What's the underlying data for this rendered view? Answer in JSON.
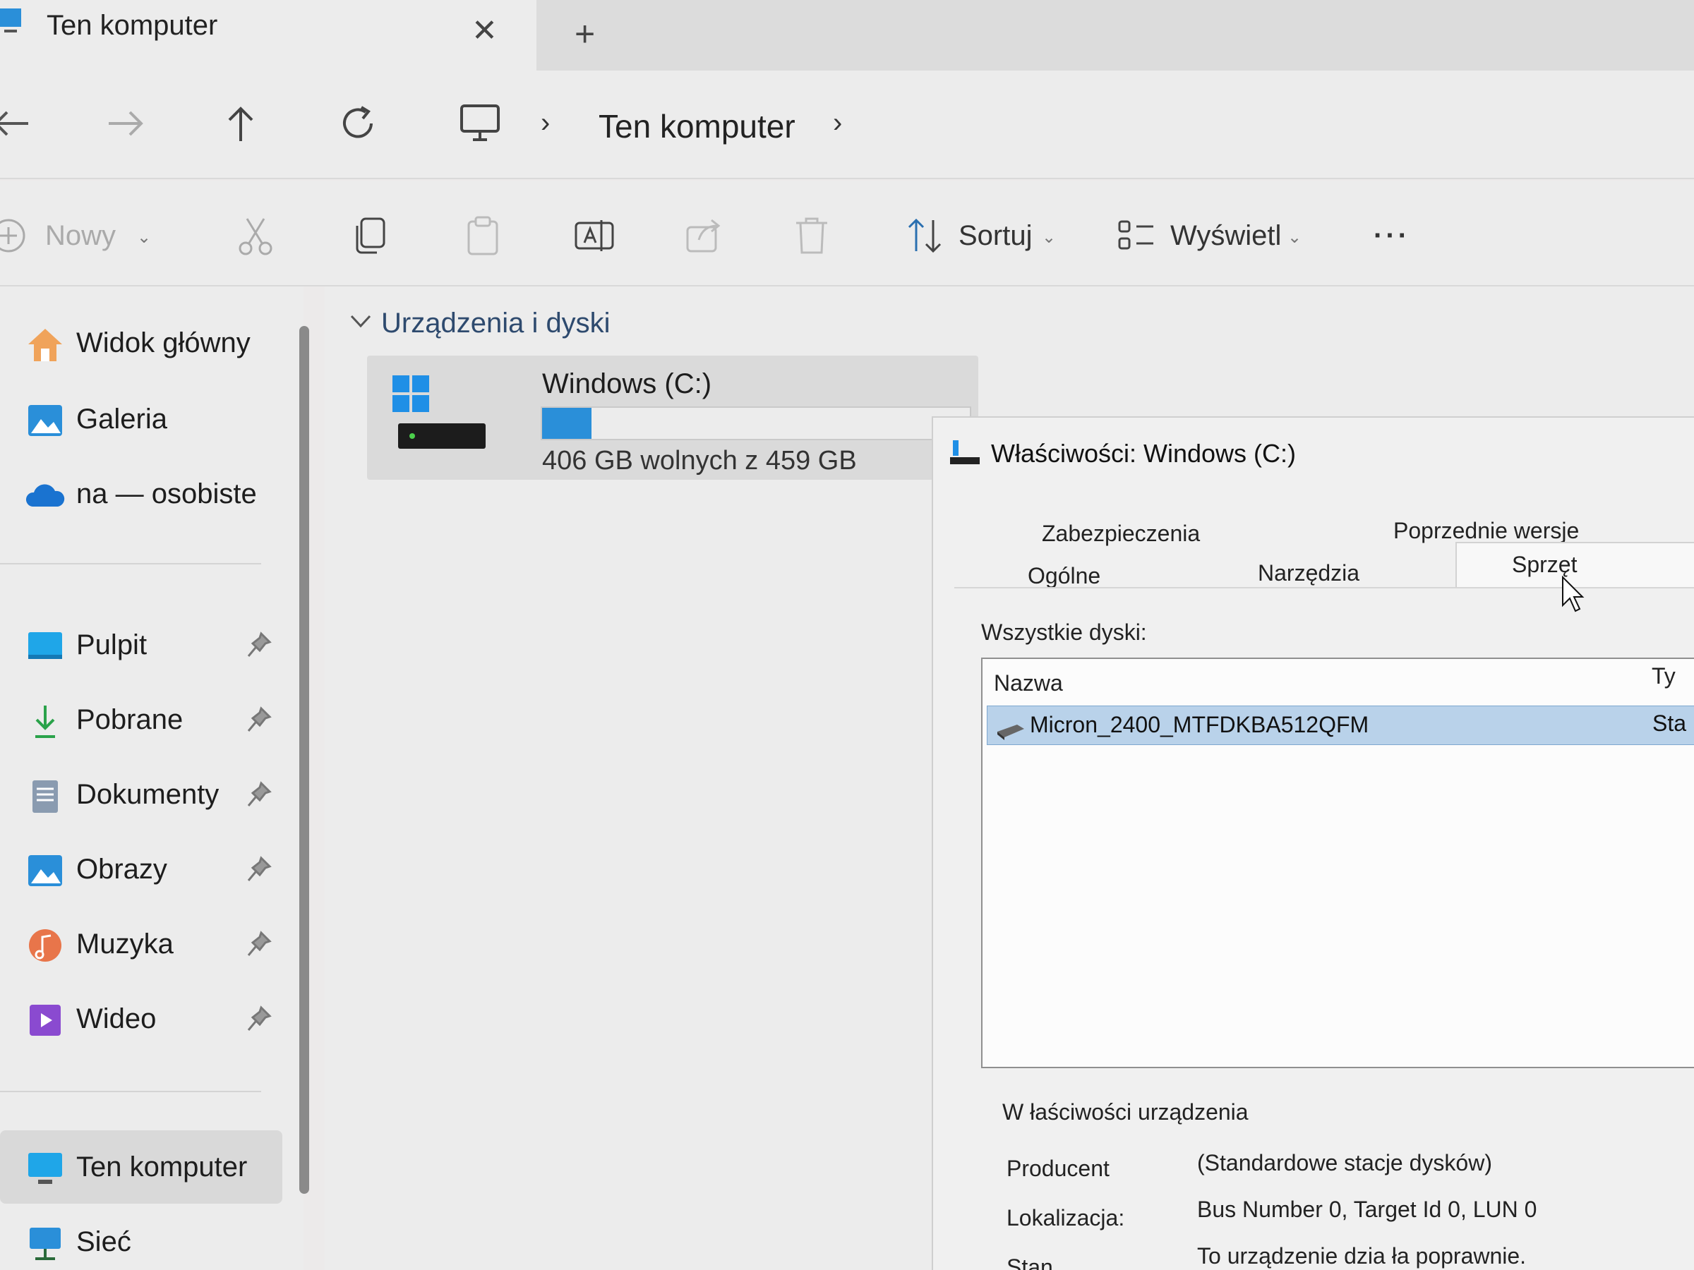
{
  "window": {
    "tab_title": "Ten komputer",
    "tab_close": "✕",
    "new_tab": "+"
  },
  "address_bar": {
    "path": "Ten komputer",
    "chevron": "›"
  },
  "command_bar": {
    "new_label": "Nowy",
    "sort_label": "Sortuj",
    "view_label": "Wyświetl",
    "more_label": "···",
    "dropdown_chevron": "⌄"
  },
  "sidebar": {
    "items": [
      {
        "label": "Widok główny",
        "icon": "home-icon"
      },
      {
        "label": "Galeria",
        "icon": "gallery-icon"
      },
      {
        "label": "na — osobiste",
        "icon": "onedrive-icon"
      },
      {
        "label": "Pulpit",
        "icon": "desktop-icon",
        "pinned": true
      },
      {
        "label": "Pobrane",
        "icon": "download-icon",
        "pinned": true
      },
      {
        "label": "Dokumenty",
        "icon": "documents-icon",
        "pinned": true
      },
      {
        "label": "Obrazy",
        "icon": "pictures-icon",
        "pinned": true
      },
      {
        "label": "Muzyka",
        "icon": "music-icon",
        "pinned": true
      },
      {
        "label": "Wideo",
        "icon": "video-icon",
        "pinned": true
      },
      {
        "label": "Ten komputer",
        "icon": "this-pc-icon",
        "selected": true
      },
      {
        "label": "Sieć",
        "icon": "network-icon"
      }
    ]
  },
  "main": {
    "group_title": "Urządzenia i dyski",
    "drive": {
      "name": "Windows (C:)",
      "free_text": "406 GB wolnych z 459 GB",
      "used_fraction": 0.115,
      "bar_color": "#2a8fd9"
    }
  },
  "dialog": {
    "title": "Właściwości: Windows (C:)",
    "tabs_row1": [
      "Zabezpieczenia",
      "Poprzednie wersje"
    ],
    "tabs_row2": [
      "Ogólne",
      "Narzędzia",
      "Sprzęt"
    ],
    "active_tab": "Sprzęt",
    "all_disks_label": "Wszystkie dyski:",
    "columns": {
      "name": "Nazwa",
      "type": "Ty"
    },
    "disk": {
      "name": "Micron_2400_MTFDKBA512QFM",
      "type": "Sta"
    },
    "device_props_title": "W łaściwości urządzenia",
    "props": [
      {
        "label": "Producent",
        "value": "(Standardowe stacje dysków)"
      },
      {
        "label": "Lokalizacja:",
        "value": "Bus Number 0, Target Id 0, LUN 0"
      },
      {
        "label": "Stan",
        "value": "To urządzenie dzia ła poprawnie."
      }
    ]
  }
}
